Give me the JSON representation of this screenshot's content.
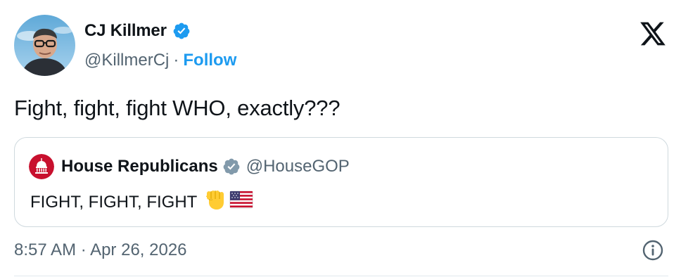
{
  "author": {
    "display_name": "CJ Killmer",
    "handle": "@KillmerCj",
    "separator": "·",
    "follow_label": "Follow",
    "verified_color": "#1d9bf0"
  },
  "tweet": {
    "text": "Fight, fight, fight WHO, exactly???",
    "time": "8:57 AM",
    "separator": "·",
    "date": "Apr 26, 2026"
  },
  "quoted_tweet": {
    "display_name": "House Republicans",
    "handle": "@HouseGOP",
    "text": "FIGHT, FIGHT, FIGHT",
    "emojis": [
      "raised-fist-emoji",
      "us-flag-emoji"
    ],
    "badge_color": "#829aab",
    "avatar_color": "#c8102e"
  },
  "icons": {
    "brand": "x-logo-icon",
    "info": "info-icon"
  },
  "colors": {
    "text_primary": "#0f1419",
    "text_secondary": "#536471",
    "link": "#1d9bf0",
    "border": "#cfd9de"
  }
}
